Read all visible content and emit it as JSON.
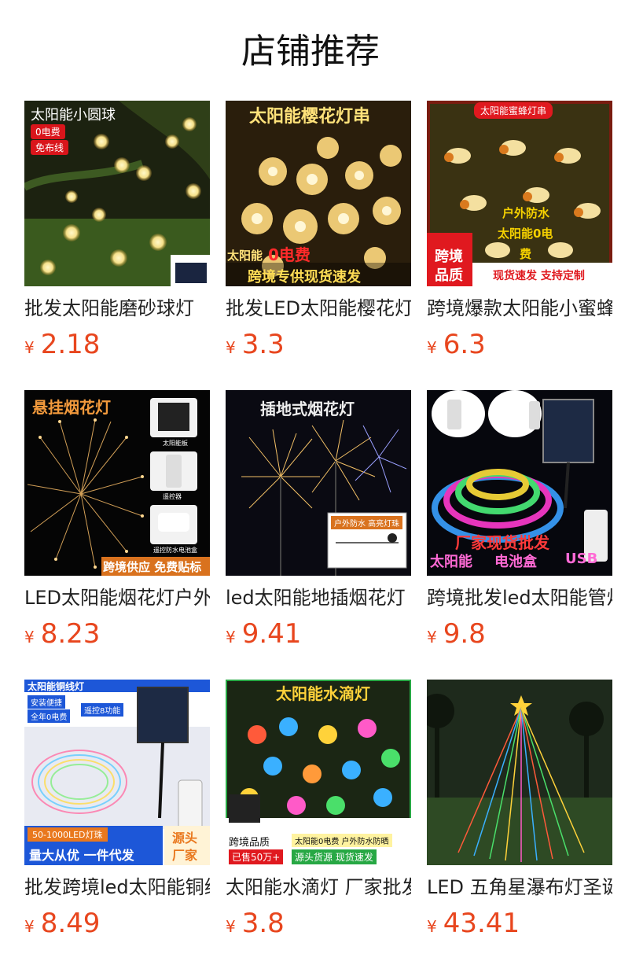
{
  "page_title": "店铺推荐",
  "currency_symbol": "¥",
  "products": [
    {
      "title": "批发太阳能磨砂球灯",
      "price": "2.18",
      "image_text": [
        "太阳能小圆球",
        "0电费",
        "免布线"
      ]
    },
    {
      "title": "批发LED太阳能樱花灯串",
      "price": "3.3",
      "image_text": [
        "太阳能樱花灯串",
        "太阳能",
        "0电费",
        "跨境专供现货速发"
      ]
    },
    {
      "title": "跨境爆款太阳能小蜜蜂灯串",
      "price": "6.3",
      "image_text": [
        "太阳能蜜蜂灯串",
        "户外防水",
        "太阳能0电",
        "费",
        "跨境",
        "品质",
        "现货速发 支持定制"
      ]
    },
    {
      "title": "LED太阳能烟花灯户外",
      "price": "8.23",
      "image_text": [
        "悬挂烟花灯",
        "太阳能板",
        "遥控器",
        "遥控防水电池盒",
        "跨境供应 免费贴标"
      ]
    },
    {
      "title": "led太阳能地插烟花灯",
      "price": "9.41",
      "image_text": [
        "插地式烟花灯",
        "户外防水 高亮灯珠"
      ]
    },
    {
      "title": "跨境批发led太阳能管灯",
      "price": "9.8",
      "image_text": [
        "厂家现货批发",
        "太阳能",
        "电池盒",
        "USB"
      ]
    },
    {
      "title": "批发跨境led太阳能铜线灯",
      "price": "8.49",
      "image_text": [
        "太阳能铜线灯",
        "安装便捷",
        "全年0电费",
        "遥控8功能",
        "50-1000LED灯珠",
        "量大从优 一件代发",
        "源头",
        "厂家"
      ]
    },
    {
      "title": "太阳能水滴灯 厂家批发",
      "price": "3.8",
      "image_text": [
        "太阳能水滴灯",
        "跨境品质",
        "已售50万+",
        "太阳能0电费 户外防水防晒",
        "源头货源 现货速发"
      ]
    },
    {
      "title": "LED 五角星瀑布灯圣诞",
      "price": "43.41",
      "image_text": []
    }
  ]
}
